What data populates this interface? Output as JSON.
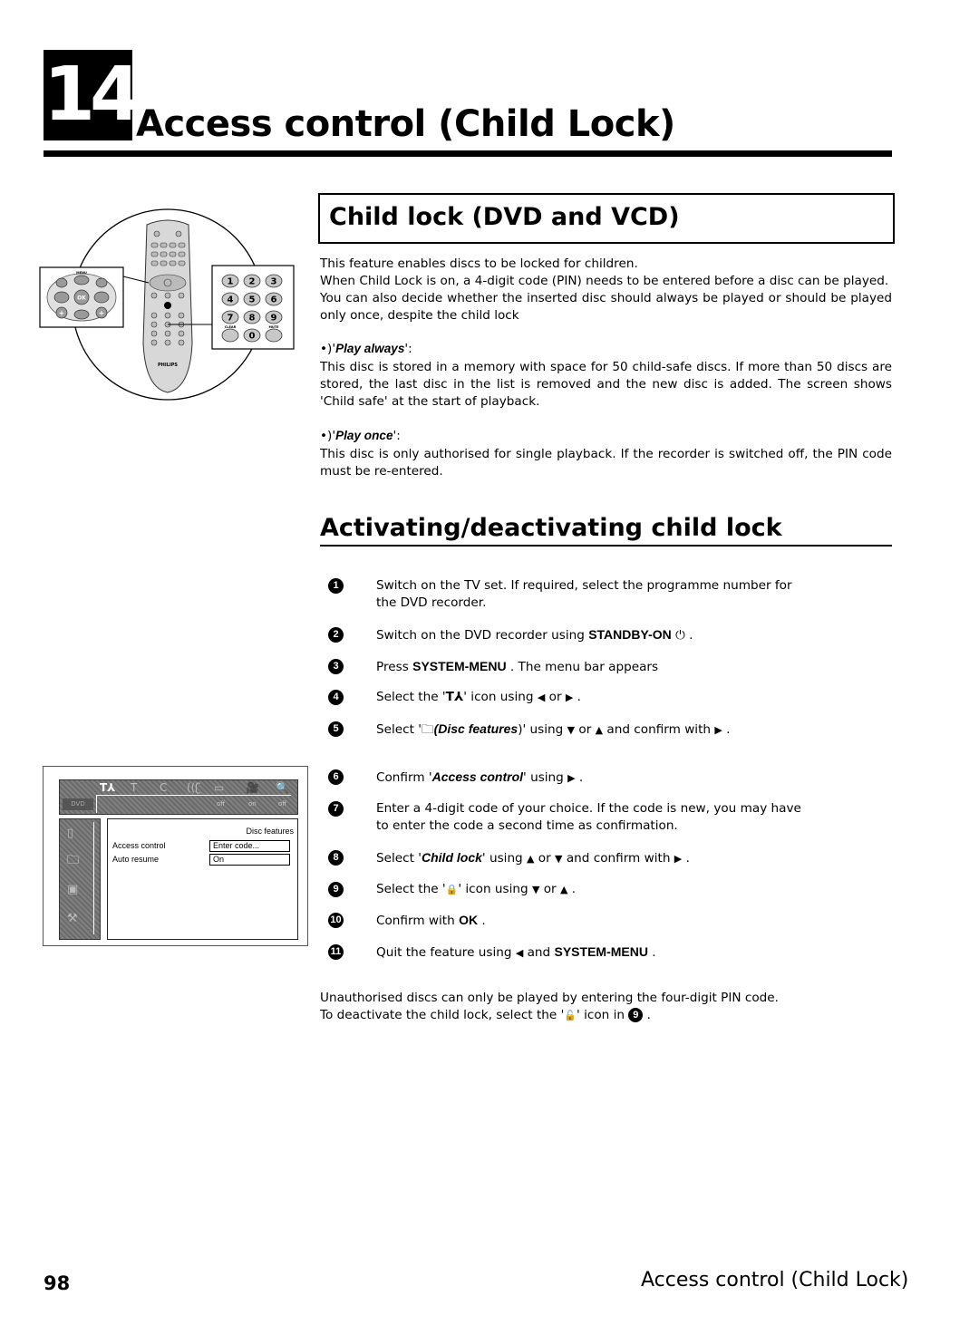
{
  "chapter": {
    "number": "14",
    "title": "Access control (Child Lock)"
  },
  "section1": {
    "title": "Child lock (DVD and VCD)",
    "intro": [
      "This feature enables discs to be locked for children.",
      "When Child Lock is on, a 4-digit code (PIN) needs to be entered before a disc can be played.",
      "You can also decide whether the inserted disc should always be played or should be played only once, despite the child lock"
    ],
    "options": [
      {
        "prefix": "•)'",
        "label": "Play always",
        "suffix": "':",
        "text": "This disc is stored in a memory with space for 50 child-safe discs. If more than 50 discs are stored, the last disc in the list is removed and the new disc is added. The screen shows 'Child safe' at the start of playback."
      },
      {
        "prefix": "•)'",
        "label": "Play once",
        "suffix": "':",
        "text": "This disc is only authorised for single playback. If the recorder is switched off, the PIN code must be re-entered."
      }
    ]
  },
  "section2": {
    "title": "Activating/deactivating child lock",
    "steps": [
      {
        "num": "1",
        "text": "Switch on the TV set. If required, select the programme number for the DVD recorder."
      },
      {
        "num": "2",
        "pre": "Switch on the DVD recorder using ",
        "key": "STANDBY-ON",
        "icon": "⏻",
        "post": " ."
      },
      {
        "num": "3",
        "pre": "Press ",
        "key": "SYSTEM-MENU",
        "post": " . The menu bar appears"
      },
      {
        "num": "4",
        "pre": "Select the '",
        "icon": "T⅄",
        "mid": "' icon using ",
        "a1": "◀",
        "or": " or ",
        "a2": "▶",
        "post": " ."
      },
      {
        "num": "5",
        "pre": "Select '",
        "icon": "🗀",
        "ital": "(Disc features",
        "mid": ")' using ",
        "a1": "▼",
        "or": " or ",
        "a2": "▲",
        "conf": " and confirm with ",
        "a3": "▶",
        "post": " ."
      },
      {
        "num": "6",
        "pre": "Confirm '",
        "ital": "Access control",
        "mid": "' using ",
        "a1": "▶",
        "post": " ."
      },
      {
        "num": "7",
        "text": "Enter a 4-digit code of your choice. If the code is new, you may have to enter the code a second time as confirmation."
      },
      {
        "num": "8",
        "pre": "Select '",
        "ital": "Child lock",
        "mid": "' using ",
        "a1": "▲",
        "or": " or ",
        "a2": "▼",
        "conf": " and confirm with ",
        "a3": "▶",
        "post": " ."
      },
      {
        "num": "9",
        "pre": "Select the '",
        "icon": "🔒",
        "mid": "' icon using ",
        "a1": "▼",
        "or": " or ",
        "a2": "▲",
        "post": " ."
      },
      {
        "num": "10",
        "pre": "Confirm with ",
        "key": "OK",
        "post": " ."
      },
      {
        "num": "11",
        "pre": "Quit the feature using ",
        "a1": "◀",
        "mid": " and ",
        "key": "SYSTEM-MENU",
        "post": " ."
      }
    ],
    "footer_lines": {
      "line1": "Unauthorised discs can only be played by entering the four-digit PIN code.",
      "line2_pre": "To deactivate the child lock, select the '",
      "line2_icon": "🔓",
      "line2_mid": "' icon in ",
      "line2_ref": "9",
      "line2_post": " ."
    }
  },
  "remote_figure": {
    "brand": "PHILIPS",
    "nav_keys": {
      "center": "OK",
      "top_label": "MENU"
    },
    "keypad": [
      "1",
      "2",
      "3",
      "4",
      "5",
      "6",
      "7",
      "8",
      "9",
      "CLEAR",
      "0",
      "MUTE"
    ]
  },
  "osd": {
    "top_icons": [
      "T⅄",
      "T",
      "C",
      "((ʗ",
      "▭",
      "🎥",
      "🔍"
    ],
    "bottom_values": [
      "off",
      "on",
      "off"
    ],
    "dvd_label": "DVD",
    "panel_title": "Disc features",
    "rows": [
      {
        "label": "Access control",
        "value": "Enter code..."
      },
      {
        "label": "Auto resume",
        "value": "On"
      }
    ]
  },
  "footer": {
    "page_number": "98",
    "running_title": "Access control (Child Lock)"
  }
}
